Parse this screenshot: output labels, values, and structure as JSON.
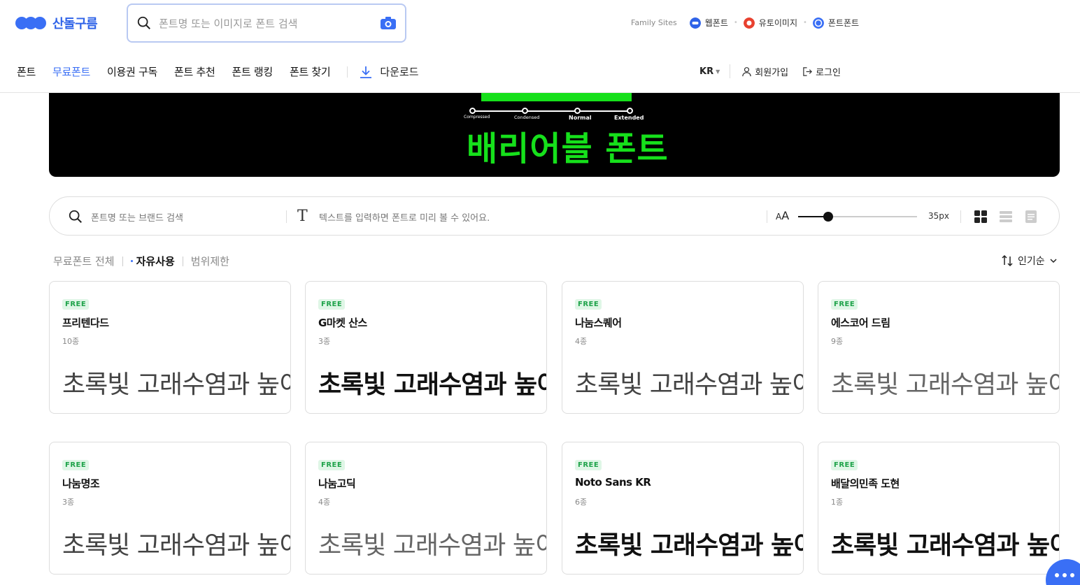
{
  "header": {
    "logo_text": "산돌구름",
    "search_placeholder": "폰트명 또는 이미지로 폰트 검색",
    "family_label": "Family Sites",
    "family_sites": [
      {
        "label": "웹폰트",
        "color": "#2f63e8"
      },
      {
        "label": "유토이미지",
        "color": "#e8412f"
      },
      {
        "label": "폰트폰트",
        "color": "#3a6ff5"
      }
    ]
  },
  "nav": {
    "items": [
      "폰트",
      "무료폰트",
      "이용권 구독",
      "폰트 추천",
      "폰트 랭킹",
      "폰트 찾기"
    ],
    "active_index": 1,
    "download_label": "다운로드"
  },
  "user_nav": {
    "lang": "KR",
    "signup": "회원가입",
    "login": "로그인"
  },
  "banner": {
    "labels": [
      "Compressed",
      "Condensed",
      "Normal",
      "Extended"
    ],
    "title": "배리어블 폰트"
  },
  "filter": {
    "search_placeholder": "폰트명 또는 브랜드 검색",
    "text_placeholder": "텍스트를 입력하면 폰트로 미리 볼 수 있어요.",
    "size_icon_label": "A",
    "size_icon_label_small": "A",
    "size_value": "35px",
    "size_fraction": 0.25
  },
  "subfilters": {
    "items": [
      "무료폰트 전체",
      "자유사용",
      "범위제한"
    ],
    "active_index": 1
  },
  "sort": {
    "label": "인기순"
  },
  "preview_text": "초록빛 고래수염과 높이뛰기",
  "cards": [
    {
      "badge": "FREE",
      "name": "프리텐다드",
      "count": "10종",
      "weight": "light"
    },
    {
      "badge": "FREE",
      "name": "G마켓 산스",
      "count": "3종",
      "weight": "black"
    },
    {
      "badge": "FREE",
      "name": "나눔스퀘어",
      "count": "4종",
      "weight": "light"
    },
    {
      "badge": "FREE",
      "name": "에스코어 드림",
      "count": "9종",
      "weight": "thin"
    },
    {
      "badge": "FREE",
      "name": "나눔명조",
      "count": "3종",
      "weight": "light"
    },
    {
      "badge": "FREE",
      "name": "나눔고딕",
      "count": "4종",
      "weight": "thin"
    },
    {
      "badge": "FREE",
      "name": "Noto Sans KR",
      "count": "6종",
      "weight": "black"
    },
    {
      "badge": "FREE",
      "name": "배달의민족 도현",
      "count": "1종",
      "weight": "black"
    }
  ],
  "colors": {
    "accent": "#3a6ff5",
    "banner_green": "#16e01b",
    "free_badge_bg": "#dff6e6",
    "free_badge_text": "#1fa34a"
  }
}
